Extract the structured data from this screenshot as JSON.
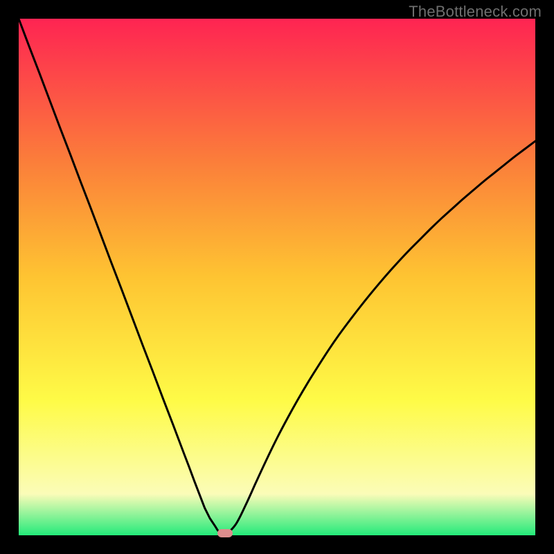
{
  "watermark": "TheBottleneck.com",
  "colors": {
    "frame": "#000000",
    "gradient_top": "#fe2452",
    "gradient_mid_upper": "#fb7f3a",
    "gradient_mid": "#fec432",
    "gradient_mid_lower": "#fefb47",
    "gradient_lower": "#fbfcb8",
    "gradient_bottom": "#23ea7a",
    "curve": "#000000",
    "marker": "#dd8d8d"
  },
  "chart_data": {
    "type": "line",
    "title": "",
    "xlabel": "",
    "ylabel": "",
    "xlim": [
      0,
      100
    ],
    "ylim": [
      0,
      100
    ],
    "x": [
      0,
      2,
      4,
      6,
      8,
      10,
      12,
      14,
      16,
      18,
      20,
      22,
      24,
      26,
      28,
      30,
      32,
      33,
      34,
      35,
      36,
      37,
      38,
      38.5,
      39,
      39.5,
      40,
      42,
      44,
      46,
      48,
      50,
      52,
      54,
      56,
      58,
      60,
      62,
      64,
      66,
      68,
      70,
      72,
      74,
      76,
      78,
      80,
      82,
      84,
      86,
      88,
      90,
      92,
      94,
      96,
      98,
      100
    ],
    "values": [
      100,
      94.7,
      89.5,
      84.2,
      78.9,
      73.7,
      68.4,
      63.2,
      57.9,
      52.6,
      47.4,
      42.1,
      36.8,
      31.6,
      26.3,
      21.1,
      15.8,
      13.2,
      10.5,
      7.9,
      5.3,
      3.3,
      1.8,
      1.0,
      0.4,
      0.1,
      0.0,
      2.1,
      6.0,
      10.4,
      14.7,
      18.8,
      22.6,
      26.2,
      29.6,
      32.8,
      35.9,
      38.8,
      41.5,
      44.1,
      46.6,
      49.0,
      51.3,
      53.5,
      55.6,
      57.6,
      59.6,
      61.5,
      63.3,
      65.1,
      66.8,
      68.5,
      70.1,
      71.7,
      73.3,
      74.8,
      76.3
    ],
    "minimum_point": {
      "x": 40,
      "y": 0
    },
    "series_name": "bottleneck_curve"
  }
}
